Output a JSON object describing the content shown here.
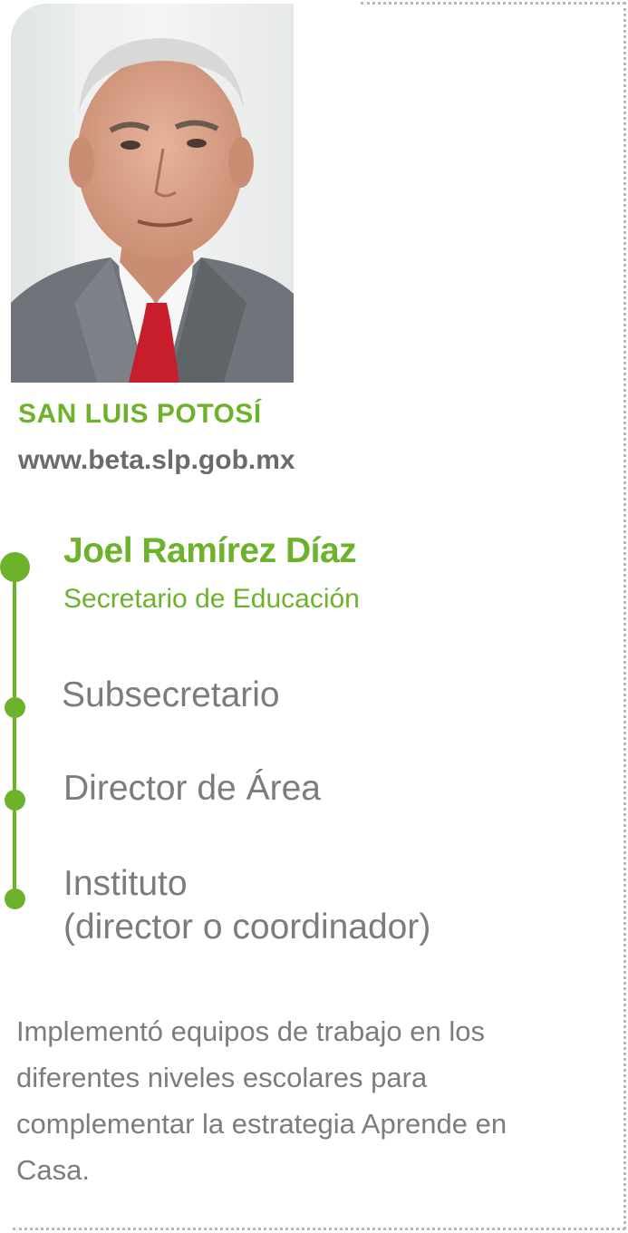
{
  "profile": {
    "state": "SAN LUIS POTOSÍ",
    "url": "www.beta.slp.gob.mx",
    "name": "Joel Ramírez Díaz",
    "role": "Secretario de Educación"
  },
  "hierarchy": {
    "level_1": "Subsecretario",
    "level_2": "Director de Área",
    "level_3_line1": "Instituto",
    "level_3_line2": "(director o coordinador)"
  },
  "description": "Implementó equipos de trabajo en los diferentes niveles escolares para complementar la estrategia Aprende en Casa.",
  "colors": {
    "accent_green": "#6cb22a",
    "text_gray": "#7c7c7c",
    "border_gray": "#b8b8b8"
  },
  "icons": {
    "portrait": "portrait-photo"
  }
}
